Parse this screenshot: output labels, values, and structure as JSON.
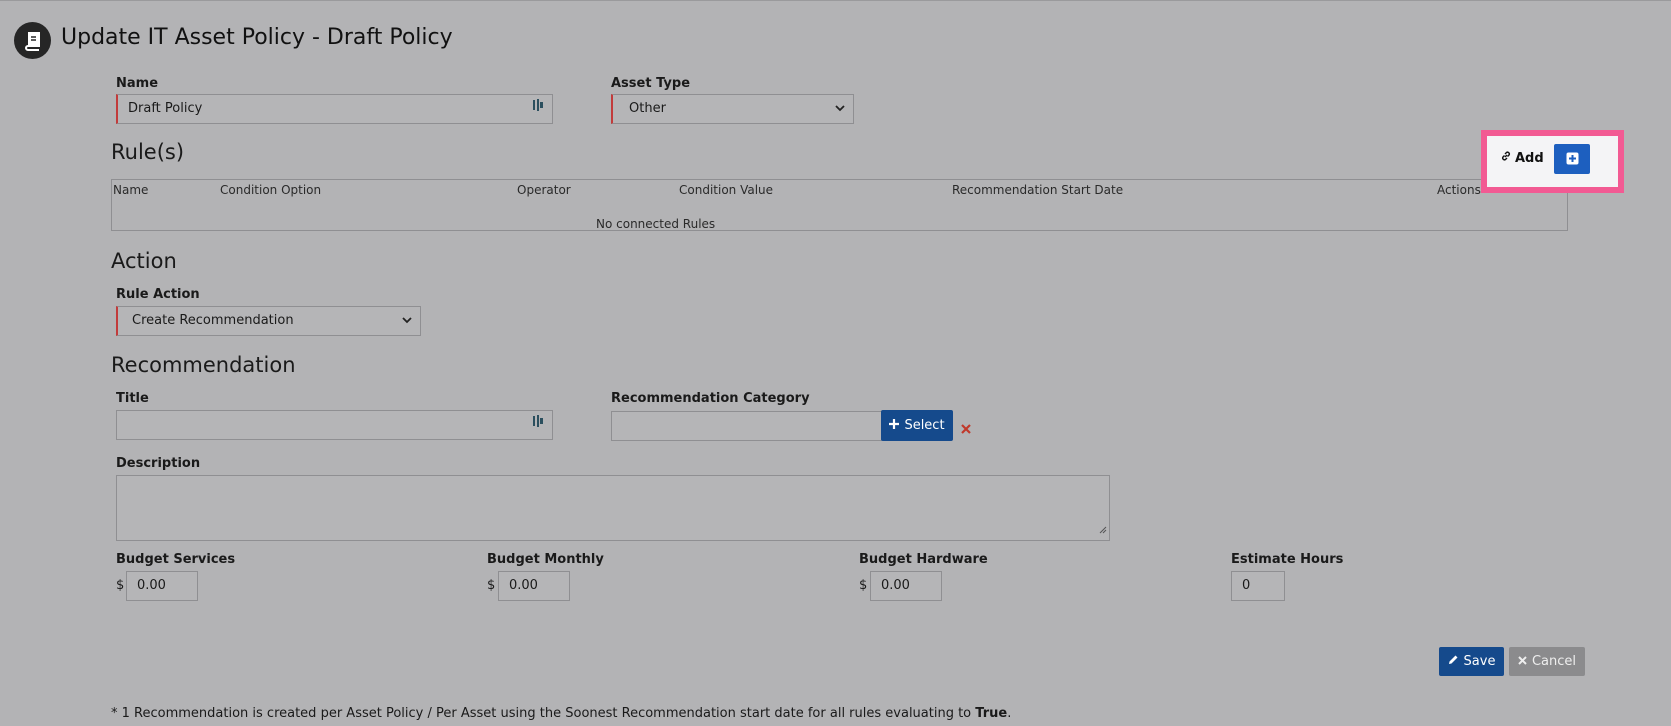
{
  "header": {
    "title": "Update IT Asset Policy - Draft Policy",
    "icon": "policy-book-icon"
  },
  "form": {
    "name_label": "Name",
    "name_value": "Draft Policy",
    "asset_type_label": "Asset Type",
    "asset_type_value": "Other"
  },
  "rules": {
    "section_title": "Rule(s)",
    "add_label": "Add",
    "columns": [
      "Name",
      "Condition Option",
      "Operator",
      "Condition Value",
      "Recommendation Start Date",
      "Actions"
    ],
    "empty_message": "No connected Rules"
  },
  "action": {
    "section_title": "Action",
    "rule_action_label": "Rule Action",
    "rule_action_value": "Create Recommendation"
  },
  "recommendation": {
    "section_title": "Recommendation",
    "title_label": "Title",
    "title_value": "",
    "category_label": "Recommendation Category",
    "category_value": "",
    "select_label": "Select",
    "description_label": "Description",
    "description_value": "",
    "budget_services_label": "Budget Services",
    "budget_services_value": "0.00",
    "budget_monthly_label": "Budget Monthly",
    "budget_monthly_value": "0.00",
    "budget_hardware_label": "Budget Hardware",
    "budget_hardware_value": "0.00",
    "estimate_hours_label": "Estimate Hours",
    "estimate_hours_value": "0",
    "currency_symbol": "$"
  },
  "buttons": {
    "save_label": "Save",
    "cancel_label": "Cancel"
  },
  "footnote": {
    "text": "* 1 Recommendation is created per Asset Policy / Per Asset using the Soonest Recommendation start date for all rules evaluating to ",
    "bold": "True",
    "end": "."
  },
  "colors": {
    "primary": "#154a8c",
    "add_button": "#1d5fbf",
    "highlight": "#f25a93",
    "required": "#c23b3b",
    "remove": "#c0392b"
  }
}
